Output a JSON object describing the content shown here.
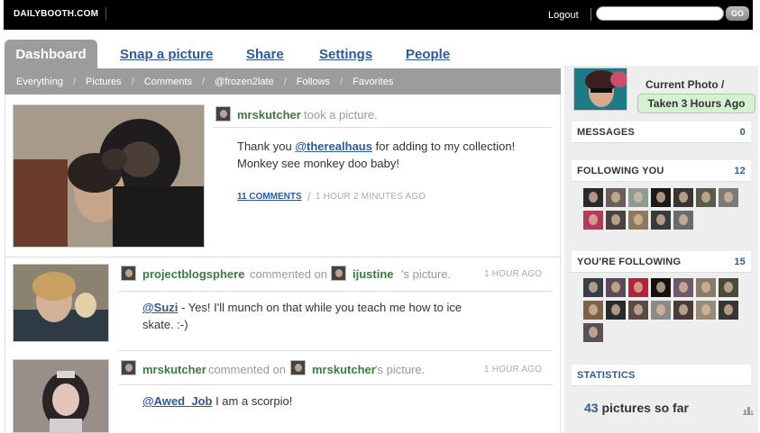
{
  "header": {
    "logo": "DAILYBOOTH.COM",
    "logout": "Logout",
    "search_placeholder": "",
    "go": "GO"
  },
  "nav": {
    "tabs": [
      "Dashboard",
      "Snap a picture",
      "Share",
      "Settings",
      "People"
    ],
    "subnav": [
      "Everything",
      "Pictures",
      "Comments",
      "@frozen2late",
      "Follows",
      "Favorites"
    ]
  },
  "feed": [
    {
      "user": "mrskutcher",
      "action": "took a picture.",
      "mention": "@therealhaus",
      "text_before": "Thank you ",
      "text_after": " for adding to my collection! Monkey see monkey doo baby!",
      "comments": "11 COMMENTS",
      "time": "1 HOUR 2 MINUTES AGO"
    },
    {
      "user": "projectblogsphere",
      "action": "commented on",
      "target": "ijustine",
      "target_suffix": "'s picture.",
      "time": "1 HOUR AGO",
      "mention": "@Suzi",
      "text": " - Yes! I'll munch on that while you teach me how to ice skate. :-)"
    },
    {
      "user": "mrskutcher",
      "action": "commented on",
      "target": "mrskutcher",
      "target_suffix": "'s picture.",
      "time": "1 HOUR AGO",
      "mention": "@Awed_Job",
      "text": " I am a scorpio!"
    }
  ],
  "sidebar": {
    "current_photo": "Current Photo /",
    "taken": "Taken 3 Hours Ago",
    "messages": {
      "label": "MESSAGES",
      "count": "0"
    },
    "following_you": {
      "label": "FOLLOWING YOU",
      "count": "12"
    },
    "youre_following": {
      "label": "YOU'RE FOLLOWING",
      "count": "15"
    },
    "statistics": {
      "label": "STATISTICS",
      "count": "43",
      "suffix": " pictures so far"
    }
  },
  "colors": {
    "link": "#2d5a96",
    "username": "#3d7a3d",
    "tab_bg": "#9c9c9c",
    "badge_bg": "#d6f0d2"
  }
}
